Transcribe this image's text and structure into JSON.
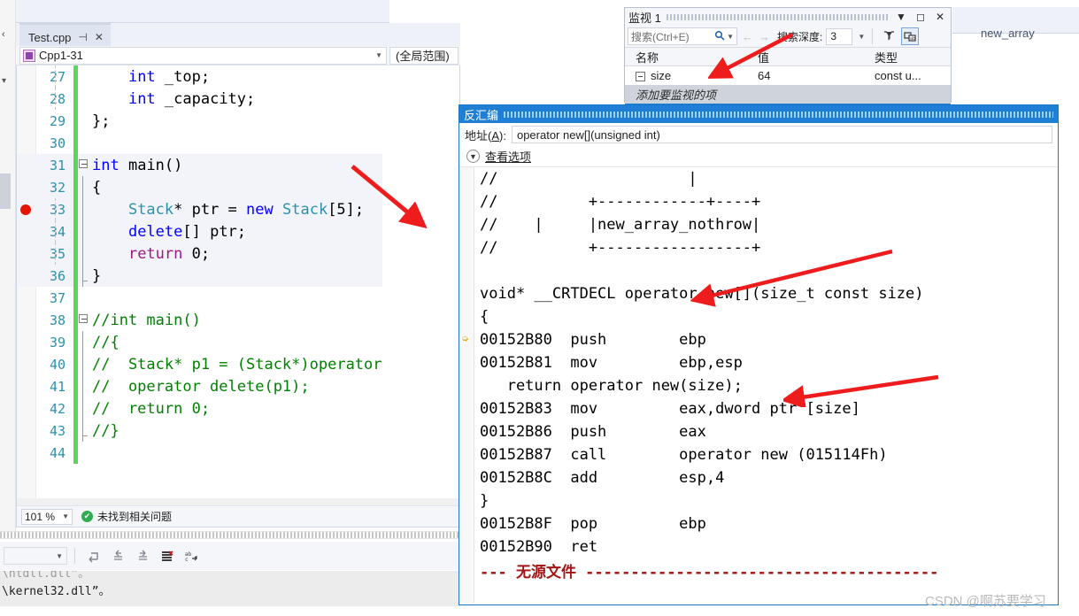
{
  "editor": {
    "tab": {
      "title": "Test.cpp",
      "pin_glyph": "⊣",
      "close_glyph": "✕"
    },
    "nav_left": "Cpp1-31",
    "nav_right": "(全局范围)",
    "zoom": "101 %",
    "status": "未找到相关问题",
    "lines": [
      {
        "num": "27",
        "indent": 2,
        "segments": [
          {
            "t": "    ",
            "c": ""
          },
          {
            "t": "int",
            "c": "kw"
          },
          {
            "t": " _top;",
            "c": ""
          }
        ]
      },
      {
        "num": "28",
        "segments": [
          {
            "t": "    ",
            "c": ""
          },
          {
            "t": "int",
            "c": "kw"
          },
          {
            "t": " _capacity;",
            "c": ""
          }
        ]
      },
      {
        "num": "29",
        "segments": [
          {
            "t": "};",
            "c": ""
          }
        ]
      },
      {
        "num": "30",
        "segments": [
          {
            "t": "",
            "c": ""
          }
        ]
      },
      {
        "num": "31",
        "segments": [
          {
            "t": "int",
            "c": "kw"
          },
          {
            "t": " ",
            "c": ""
          },
          {
            "t": "main",
            "c": ""
          },
          {
            "t": "()",
            "c": ""
          }
        ]
      },
      {
        "num": "32",
        "segments": [
          {
            "t": "{",
            "c": ""
          }
        ]
      },
      {
        "num": "33",
        "segments": [
          {
            "t": "    ",
            "c": ""
          },
          {
            "t": "Stack",
            "c": "type"
          },
          {
            "t": "* ptr = ",
            "c": ""
          },
          {
            "t": "new",
            "c": "kw"
          },
          {
            "t": " ",
            "c": ""
          },
          {
            "t": "Stack",
            "c": "type"
          },
          {
            "t": "[5];",
            "c": ""
          }
        ]
      },
      {
        "num": "34",
        "segments": [
          {
            "t": "    ",
            "c": ""
          },
          {
            "t": "delete",
            "c": "kw"
          },
          {
            "t": "[] ptr;",
            "c": ""
          }
        ]
      },
      {
        "num": "35",
        "segments": [
          {
            "t": "    ",
            "c": ""
          },
          {
            "t": "return",
            "c": "ctl"
          },
          {
            "t": " 0;",
            "c": ""
          }
        ]
      },
      {
        "num": "36",
        "segments": [
          {
            "t": "}",
            "c": ""
          }
        ]
      },
      {
        "num": "37",
        "segments": [
          {
            "t": "",
            "c": ""
          }
        ]
      },
      {
        "num": "38",
        "segments": [
          {
            "t": "//int main()",
            "c": "cmt"
          }
        ]
      },
      {
        "num": "39",
        "segments": [
          {
            "t": "//{",
            "c": "cmt"
          }
        ]
      },
      {
        "num": "40",
        "segments": [
          {
            "t": "//  Stack* p1 = (Stack*)operator",
            "c": "cmt"
          }
        ]
      },
      {
        "num": "41",
        "segments": [
          {
            "t": "//  operator delete(p1);",
            "c": "cmt"
          }
        ]
      },
      {
        "num": "42",
        "segments": [
          {
            "t": "//  return 0;",
            "c": "cmt"
          }
        ]
      },
      {
        "num": "43",
        "segments": [
          {
            "t": "//}",
            "c": "cmt"
          }
        ]
      },
      {
        "num": "44",
        "segments": [
          {
            "t": "",
            "c": ""
          }
        ]
      }
    ]
  },
  "watch": {
    "title": "监视 1",
    "minimize_glyph": "▼",
    "maximize_glyph": "◻",
    "close_glyph": "✕",
    "search_placeholder": "搜索(Ctrl+E)",
    "search_glyph": "🔍",
    "prev_glyph": "←",
    "next_glyph": "→",
    "depth_label": "搜索深度:",
    "depth_value": "3",
    "columns": [
      "名称",
      "值",
      "类型"
    ],
    "rows": [
      {
        "name": "size",
        "value": "64",
        "type": "const u..."
      }
    ],
    "add_row_text": "添加要监视的项"
  },
  "disassembly": {
    "title": "反汇编",
    "address_label_pre": "地址(",
    "address_label_key": "A",
    "address_label_post": "):",
    "address_value": "operator new[](unsigned int)",
    "view_options": "查看选项",
    "no_source_text": "--- 无源文件 ---------------------------------------",
    "lines": [
      {
        "marker": "",
        "text": "//                     |",
        "style": ""
      },
      {
        "marker": "",
        "text": "//          +------------+----+",
        "style": ""
      },
      {
        "marker": "",
        "text": "//    |     |new_array_nothrow|",
        "style": ""
      },
      {
        "marker": "",
        "text": "//          +-----------------+",
        "style": ""
      },
      {
        "marker": "",
        "text": "",
        "style": ""
      },
      {
        "marker": "",
        "text": "void* __CRTDECL operator new[](size_t const size)",
        "style": ""
      },
      {
        "marker": "",
        "text": "{",
        "style": ""
      },
      {
        "marker": "arrow",
        "text": "00152B80  push        ebp",
        "style": ""
      },
      {
        "marker": "",
        "text": "00152B81  mov         ebp,esp",
        "style": ""
      },
      {
        "marker": "",
        "text": "   return operator new(size);",
        "style": ""
      },
      {
        "marker": "",
        "text": "00152B83  mov         eax,dword ptr [size]",
        "style": ""
      },
      {
        "marker": "",
        "text": "00152B86  push        eax",
        "style": ""
      },
      {
        "marker": "",
        "text": "00152B87  call        operator new (015114Fh)",
        "style": ""
      },
      {
        "marker": "",
        "text": "00152B8C  add         esp,4",
        "style": ""
      },
      {
        "marker": "",
        "text": "}",
        "style": ""
      },
      {
        "marker": "",
        "text": "00152B8F  pop         ebp",
        "style": ""
      },
      {
        "marker": "",
        "text": "00152B90  ret",
        "style": ""
      }
    ]
  },
  "output": {
    "lines": [
      "\\ntdll.dll”。",
      "\\kernel32.dll”。"
    ],
    "toolbar_icons": [
      "clear-output-icon",
      "go-to-previous-icon",
      "go-to-next-icon",
      "clear-all-icon",
      "toggle-word-wrap-icon"
    ]
  },
  "right_label": "new_array",
  "watermark": "CSDN @啊苏要学习",
  "colors": {
    "accent_blue": "#1f7fd4",
    "breakpoint_red": "#e51400",
    "change_bar_green": "#57d957",
    "arrow_red": "#ee1c1c",
    "keyword_blue": "#0000ff",
    "type_teal": "#2b91af",
    "comment_green": "#008000",
    "control_purple": "#a31584",
    "no_source_dark_red": "#a31515"
  }
}
